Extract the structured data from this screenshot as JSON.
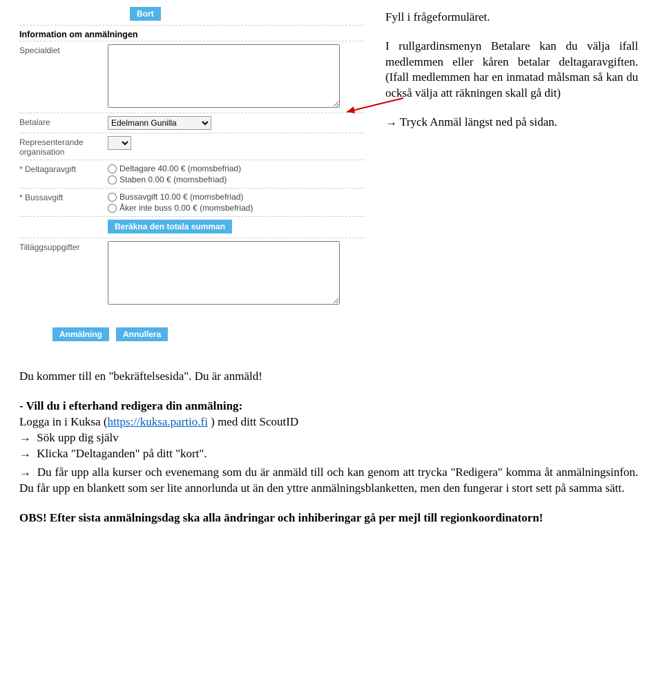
{
  "form": {
    "top_button": "Bort",
    "heading_info": "Information om anmälningen",
    "label_specialdiet": "Specialdiet",
    "label_betalare": "Betalare",
    "betalare_value": "Edelmann Gunilla",
    "label_representerande": "Representerande organisation",
    "label_deltagaravgift": "* Deltagaravgift",
    "deltagaravgift_opt1": "Deltagare 40.00 € (momsbefriad)",
    "deltagaravgift_opt2": "Staben 0.00 € (momsbefriad)",
    "label_bussavgift": "* Bussavgift",
    "bussavgift_opt1": "Bussavgift 10.00 € (momsbefriad)",
    "bussavgift_opt2": "Åker inte buss 0.00 € (momsbefriad)",
    "calc_btn": "Beräkna den totala summan",
    "label_tillagg": "Tilläggsuppgifter",
    "anmalning_btn": "Anmälning",
    "annullera_btn": "Annullera"
  },
  "side": {
    "p1": "Fyll i frågeformuläret.",
    "p2": "I rullgardinsmenyn Betalare kan du välja ifall medlemmen eller kåren betalar deltagaravgiften. (Ifall medlemmen har en inmatad målsman så kan du också välja att räkningen skall gå dit)",
    "p3": "Tryck Anmäl längst ned på sidan."
  },
  "body": {
    "p1": "Du kommer till en \"bekräftelsesida\". Du är anmäld!",
    "h1": "- Vill du i efterhand redigera din anmälning:",
    "line1_pre": "Logga in i Kuksa (",
    "line1_link": "https://kuksa.partio.fi",
    "line1_post": " ) med ditt ScoutID",
    "line2": "Sök upp dig själv",
    "line3": "Klicka \"Deltaganden\" på ditt \"kort\".",
    "line4": "Du får upp alla kurser och evenemang som du är anmäld till och kan genom att trycka \"Redigera\" komma åt anmälningsinfon. Du får upp en blankett som ser lite annorlunda ut än den yttre anmälningsblanketten, men den fungerar i stort sett på samma sätt.",
    "obs": "OBS! Efter sista anmälningsdag ska alla ändringar och inhiberingar gå per mejl till regionkoordinatorn!"
  }
}
